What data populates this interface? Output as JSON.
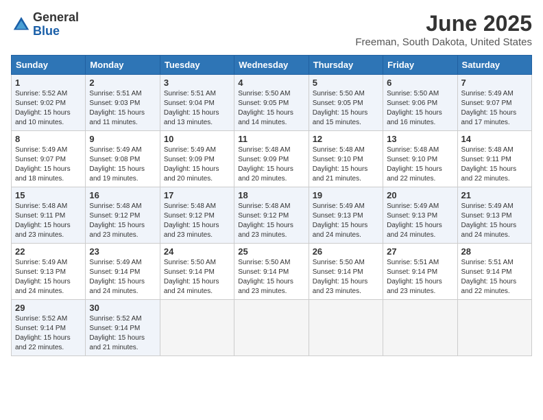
{
  "logo": {
    "general": "General",
    "blue": "Blue"
  },
  "title": {
    "month": "June 2025",
    "location": "Freeman, South Dakota, United States"
  },
  "calendar": {
    "headers": [
      "Sunday",
      "Monday",
      "Tuesday",
      "Wednesday",
      "Thursday",
      "Friday",
      "Saturday"
    ],
    "weeks": [
      [
        {
          "day": "",
          "info": ""
        },
        {
          "day": "2",
          "info": "Sunrise: 5:51 AM\nSunset: 9:03 PM\nDaylight: 15 hours\nand 11 minutes."
        },
        {
          "day": "3",
          "info": "Sunrise: 5:51 AM\nSunset: 9:04 PM\nDaylight: 15 hours\nand 13 minutes."
        },
        {
          "day": "4",
          "info": "Sunrise: 5:50 AM\nSunset: 9:05 PM\nDaylight: 15 hours\nand 14 minutes."
        },
        {
          "day": "5",
          "info": "Sunrise: 5:50 AM\nSunset: 9:05 PM\nDaylight: 15 hours\nand 15 minutes."
        },
        {
          "day": "6",
          "info": "Sunrise: 5:50 AM\nSunset: 9:06 PM\nDaylight: 15 hours\nand 16 minutes."
        },
        {
          "day": "7",
          "info": "Sunrise: 5:49 AM\nSunset: 9:07 PM\nDaylight: 15 hours\nand 17 minutes."
        }
      ],
      [
        {
          "day": "1",
          "info": "Sunrise: 5:52 AM\nSunset: 9:02 PM\nDaylight: 15 hours\nand 10 minutes."
        },
        {
          "day": "9",
          "info": "Sunrise: 5:49 AM\nSunset: 9:08 PM\nDaylight: 15 hours\nand 19 minutes."
        },
        {
          "day": "10",
          "info": "Sunrise: 5:49 AM\nSunset: 9:09 PM\nDaylight: 15 hours\nand 20 minutes."
        },
        {
          "day": "11",
          "info": "Sunrise: 5:48 AM\nSunset: 9:09 PM\nDaylight: 15 hours\nand 20 minutes."
        },
        {
          "day": "12",
          "info": "Sunrise: 5:48 AM\nSunset: 9:10 PM\nDaylight: 15 hours\nand 21 minutes."
        },
        {
          "day": "13",
          "info": "Sunrise: 5:48 AM\nSunset: 9:10 PM\nDaylight: 15 hours\nand 22 minutes."
        },
        {
          "day": "14",
          "info": "Sunrise: 5:48 AM\nSunset: 9:11 PM\nDaylight: 15 hours\nand 22 minutes."
        }
      ],
      [
        {
          "day": "8",
          "info": "Sunrise: 5:49 AM\nSunset: 9:07 PM\nDaylight: 15 hours\nand 18 minutes."
        },
        {
          "day": "16",
          "info": "Sunrise: 5:48 AM\nSunset: 9:12 PM\nDaylight: 15 hours\nand 23 minutes."
        },
        {
          "day": "17",
          "info": "Sunrise: 5:48 AM\nSunset: 9:12 PM\nDaylight: 15 hours\nand 23 minutes."
        },
        {
          "day": "18",
          "info": "Sunrise: 5:48 AM\nSunset: 9:12 PM\nDaylight: 15 hours\nand 23 minutes."
        },
        {
          "day": "19",
          "info": "Sunrise: 5:49 AM\nSunset: 9:13 PM\nDaylight: 15 hours\nand 24 minutes."
        },
        {
          "day": "20",
          "info": "Sunrise: 5:49 AM\nSunset: 9:13 PM\nDaylight: 15 hours\nand 24 minutes."
        },
        {
          "day": "21",
          "info": "Sunrise: 5:49 AM\nSunset: 9:13 PM\nDaylight: 15 hours\nand 24 minutes."
        }
      ],
      [
        {
          "day": "15",
          "info": "Sunrise: 5:48 AM\nSunset: 9:11 PM\nDaylight: 15 hours\nand 23 minutes."
        },
        {
          "day": "23",
          "info": "Sunrise: 5:49 AM\nSunset: 9:14 PM\nDaylight: 15 hours\nand 24 minutes."
        },
        {
          "day": "24",
          "info": "Sunrise: 5:50 AM\nSunset: 9:14 PM\nDaylight: 15 hours\nand 24 minutes."
        },
        {
          "day": "25",
          "info": "Sunrise: 5:50 AM\nSunset: 9:14 PM\nDaylight: 15 hours\nand 23 minutes."
        },
        {
          "day": "26",
          "info": "Sunrise: 5:50 AM\nSunset: 9:14 PM\nDaylight: 15 hours\nand 23 minutes."
        },
        {
          "day": "27",
          "info": "Sunrise: 5:51 AM\nSunset: 9:14 PM\nDaylight: 15 hours\nand 23 minutes."
        },
        {
          "day": "28",
          "info": "Sunrise: 5:51 AM\nSunset: 9:14 PM\nDaylight: 15 hours\nand 22 minutes."
        }
      ],
      [
        {
          "day": "22",
          "info": "Sunrise: 5:49 AM\nSunset: 9:13 PM\nDaylight: 15 hours\nand 24 minutes."
        },
        {
          "day": "30",
          "info": "Sunrise: 5:52 AM\nSunset: 9:14 PM\nDaylight: 15 hours\nand 21 minutes."
        },
        {
          "day": "",
          "info": ""
        },
        {
          "day": "",
          "info": ""
        },
        {
          "day": "",
          "info": ""
        },
        {
          "day": "",
          "info": ""
        },
        {
          "day": "",
          "info": ""
        }
      ],
      [
        {
          "day": "29",
          "info": "Sunrise: 5:52 AM\nSunset: 9:14 PM\nDaylight: 15 hours\nand 22 minutes."
        },
        {
          "day": "",
          "info": ""
        },
        {
          "day": "",
          "info": ""
        },
        {
          "day": "",
          "info": ""
        },
        {
          "day": "",
          "info": ""
        },
        {
          "day": "",
          "info": ""
        },
        {
          "day": "",
          "info": ""
        }
      ]
    ]
  }
}
